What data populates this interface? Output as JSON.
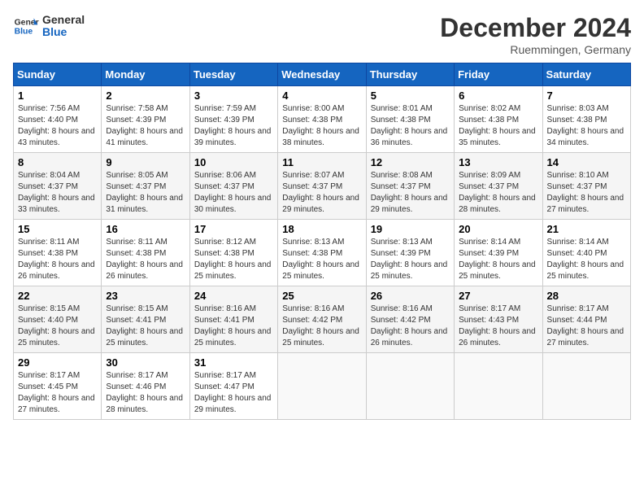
{
  "header": {
    "logo_general": "General",
    "logo_blue": "Blue",
    "month_title": "December 2024",
    "location": "Ruemmingen, Germany"
  },
  "calendar": {
    "days_of_week": [
      "Sunday",
      "Monday",
      "Tuesday",
      "Wednesday",
      "Thursday",
      "Friday",
      "Saturday"
    ],
    "weeks": [
      [
        null,
        {
          "day": "2",
          "sunrise": "7:58 AM",
          "sunset": "4:39 PM",
          "daylight": "8 hours and 41 minutes."
        },
        {
          "day": "3",
          "sunrise": "7:59 AM",
          "sunset": "4:39 PM",
          "daylight": "8 hours and 39 minutes."
        },
        {
          "day": "4",
          "sunrise": "8:00 AM",
          "sunset": "4:38 PM",
          "daylight": "8 hours and 38 minutes."
        },
        {
          "day": "5",
          "sunrise": "8:01 AM",
          "sunset": "4:38 PM",
          "daylight": "8 hours and 36 minutes."
        },
        {
          "day": "6",
          "sunrise": "8:02 AM",
          "sunset": "4:38 PM",
          "daylight": "8 hours and 35 minutes."
        },
        {
          "day": "7",
          "sunrise": "8:03 AM",
          "sunset": "4:38 PM",
          "daylight": "8 hours and 34 minutes."
        }
      ],
      [
        {
          "day": "1",
          "sunrise": "7:56 AM",
          "sunset": "4:40 PM",
          "daylight": "8 hours and 43 minutes."
        },
        {
          "day": "8",
          "sunrise": "8:04 AM",
          "sunset": "4:37 PM",
          "daylight": "8 hours and 33 minutes."
        },
        {
          "day": "9",
          "sunrise": "8:05 AM",
          "sunset": "4:37 PM",
          "daylight": "8 hours and 31 minutes."
        },
        {
          "day": "10",
          "sunrise": "8:06 AM",
          "sunset": "4:37 PM",
          "daylight": "8 hours and 30 minutes."
        },
        {
          "day": "11",
          "sunrise": "8:07 AM",
          "sunset": "4:37 PM",
          "daylight": "8 hours and 29 minutes."
        },
        {
          "day": "12",
          "sunrise": "8:08 AM",
          "sunset": "4:37 PM",
          "daylight": "8 hours and 29 minutes."
        },
        {
          "day": "13",
          "sunrise": "8:09 AM",
          "sunset": "4:37 PM",
          "daylight": "8 hours and 28 minutes."
        },
        {
          "day": "14",
          "sunrise": "8:10 AM",
          "sunset": "4:37 PM",
          "daylight": "8 hours and 27 minutes."
        }
      ],
      [
        {
          "day": "15",
          "sunrise": "8:11 AM",
          "sunset": "4:38 PM",
          "daylight": "8 hours and 26 minutes."
        },
        {
          "day": "16",
          "sunrise": "8:11 AM",
          "sunset": "4:38 PM",
          "daylight": "8 hours and 26 minutes."
        },
        {
          "day": "17",
          "sunrise": "8:12 AM",
          "sunset": "4:38 PM",
          "daylight": "8 hours and 25 minutes."
        },
        {
          "day": "18",
          "sunrise": "8:13 AM",
          "sunset": "4:38 PM",
          "daylight": "8 hours and 25 minutes."
        },
        {
          "day": "19",
          "sunrise": "8:13 AM",
          "sunset": "4:39 PM",
          "daylight": "8 hours and 25 minutes."
        },
        {
          "day": "20",
          "sunrise": "8:14 AM",
          "sunset": "4:39 PM",
          "daylight": "8 hours and 25 minutes."
        },
        {
          "day": "21",
          "sunrise": "8:14 AM",
          "sunset": "4:40 PM",
          "daylight": "8 hours and 25 minutes."
        }
      ],
      [
        {
          "day": "22",
          "sunrise": "8:15 AM",
          "sunset": "4:40 PM",
          "daylight": "8 hours and 25 minutes."
        },
        {
          "day": "23",
          "sunrise": "8:15 AM",
          "sunset": "4:41 PM",
          "daylight": "8 hours and 25 minutes."
        },
        {
          "day": "24",
          "sunrise": "8:16 AM",
          "sunset": "4:41 PM",
          "daylight": "8 hours and 25 minutes."
        },
        {
          "day": "25",
          "sunrise": "8:16 AM",
          "sunset": "4:42 PM",
          "daylight": "8 hours and 25 minutes."
        },
        {
          "day": "26",
          "sunrise": "8:16 AM",
          "sunset": "4:42 PM",
          "daylight": "8 hours and 26 minutes."
        },
        {
          "day": "27",
          "sunrise": "8:17 AM",
          "sunset": "4:43 PM",
          "daylight": "8 hours and 26 minutes."
        },
        {
          "day": "28",
          "sunrise": "8:17 AM",
          "sunset": "4:44 PM",
          "daylight": "8 hours and 27 minutes."
        }
      ],
      [
        {
          "day": "29",
          "sunrise": "8:17 AM",
          "sunset": "4:45 PM",
          "daylight": "8 hours and 27 minutes."
        },
        {
          "day": "30",
          "sunrise": "8:17 AM",
          "sunset": "4:46 PM",
          "daylight": "8 hours and 28 minutes."
        },
        {
          "day": "31",
          "sunrise": "8:17 AM",
          "sunset": "4:47 PM",
          "daylight": "8 hours and 29 minutes."
        },
        null,
        null,
        null,
        null
      ]
    ]
  }
}
